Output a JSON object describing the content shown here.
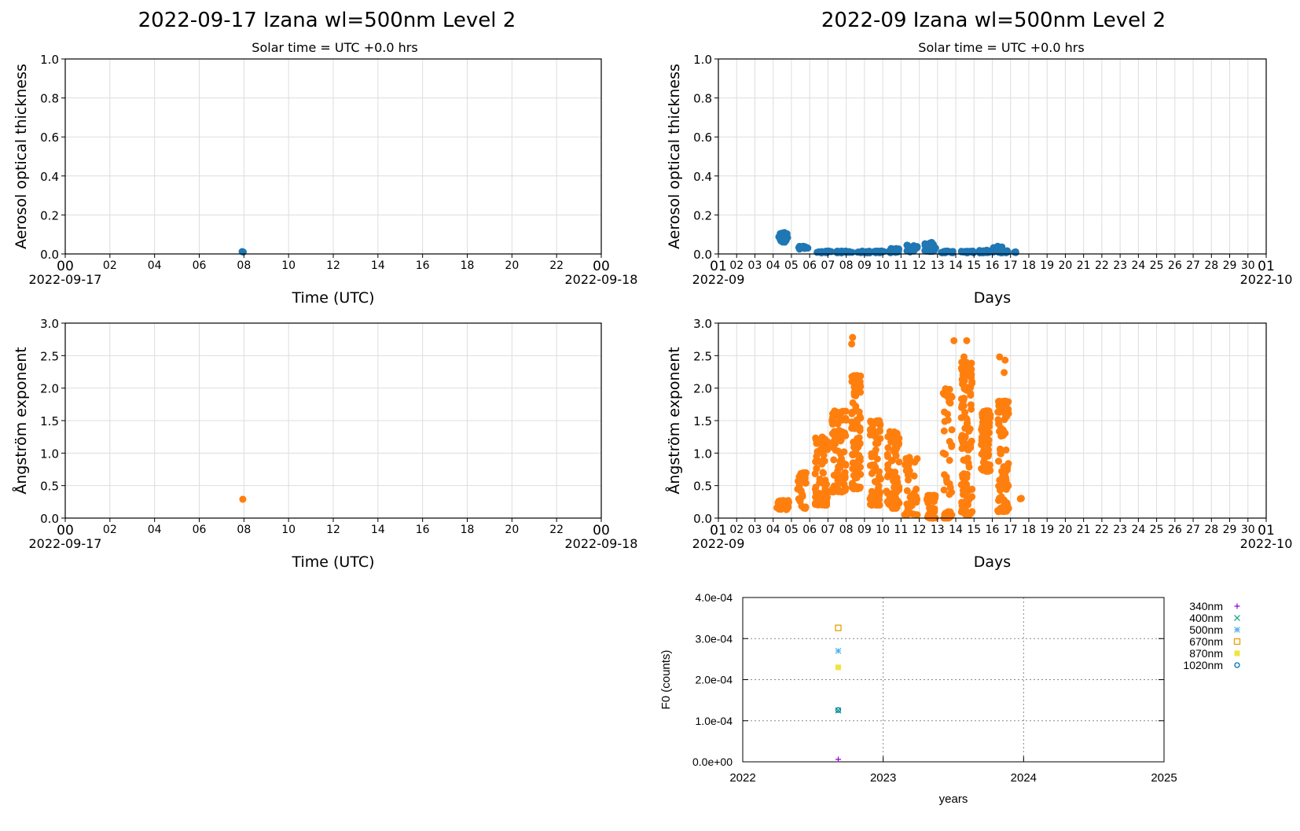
{
  "titles": {
    "left": "2022-09-17  Izana  wl=500nm  Level 2",
    "right": "2022-09  Izana  wl=500nm  Level 2"
  },
  "subtitles": {
    "left": "Solar time = UTC +0.0 hrs",
    "right": "Solar time = UTC +0.0 hrs"
  },
  "colors": {
    "aod": "#1f77b4",
    "angstrom": "#ff7f0e",
    "grid": "#dddddd"
  },
  "chart_data": [
    {
      "id": "daily-aod",
      "type": "scatter",
      "ylabel": "Aerosol optical thickness",
      "xlabel": "Time (UTC)",
      "ylim": [
        0.0,
        1.0
      ],
      "yticks": [
        "0.0",
        "0.2",
        "0.4",
        "0.6",
        "0.8",
        "1.0"
      ],
      "xticks": [
        "00",
        "02",
        "04",
        "06",
        "08",
        "10",
        "12",
        "14",
        "16",
        "18",
        "20",
        "22",
        "00"
      ],
      "xstart_label": "2022-09-17",
      "xend_label": "2022-09-18",
      "xlim_hours": [
        0,
        24
      ],
      "grid": true,
      "series": [
        {
          "points": [
            [
              7.92,
              0.012
            ],
            [
              7.97,
              0.01
            ]
          ]
        }
      ]
    },
    {
      "id": "daily-angstrom",
      "type": "scatter",
      "ylabel": "Ångström exponent",
      "xlabel": "Time (UTC)",
      "ylim": [
        0.0,
        3.0
      ],
      "yticks": [
        "0.0",
        "0.5",
        "1.0",
        "1.5",
        "2.0",
        "2.5",
        "3.0"
      ],
      "xticks": [
        "00",
        "02",
        "04",
        "06",
        "08",
        "10",
        "12",
        "14",
        "16",
        "18",
        "20",
        "22",
        "00"
      ],
      "xstart_label": "2022-09-17",
      "xend_label": "2022-09-18",
      "xlim_hours": [
        0,
        24
      ],
      "grid": true,
      "series": [
        {
          "points": [
            [
              7.95,
              0.29
            ]
          ]
        }
      ]
    },
    {
      "id": "monthly-aod",
      "type": "scatter",
      "ylabel": "Aerosol optical thickness",
      "xlabel": "Days",
      "ylim": [
        0.0,
        1.0
      ],
      "yticks": [
        "0.0",
        "0.2",
        "0.4",
        "0.6",
        "0.8",
        "1.0"
      ],
      "xticks": [
        "01",
        "02",
        "03",
        "04",
        "05",
        "06",
        "07",
        "08",
        "09",
        "10",
        "11",
        "12",
        "13",
        "14",
        "15",
        "16",
        "17",
        "18",
        "19",
        "20",
        "21",
        "22",
        "23",
        "24",
        "25",
        "26",
        "27",
        "28",
        "29",
        "30",
        "01"
      ],
      "xstart_label": "2022-09",
      "xend_label": "2022-10",
      "xlim_days": [
        1,
        31
      ],
      "grid": true,
      "clusters": [
        {
          "x0": 4.3,
          "x1": 4.8,
          "y0": 0.06,
          "y1": 0.11,
          "n": 40
        },
        {
          "x0": 5.4,
          "x1": 5.9,
          "y0": 0.02,
          "y1": 0.04,
          "n": 16
        },
        {
          "x0": 6.4,
          "x1": 7.2,
          "y0": 0.005,
          "y1": 0.015,
          "n": 18
        },
        {
          "x0": 7.4,
          "x1": 8.4,
          "y0": 0.005,
          "y1": 0.015,
          "n": 20
        },
        {
          "x0": 8.6,
          "x1": 9.3,
          "y0": 0.005,
          "y1": 0.015,
          "n": 16
        },
        {
          "x0": 9.5,
          "x1": 10.1,
          "y0": 0.005,
          "y1": 0.015,
          "n": 14
        },
        {
          "x0": 10.3,
          "x1": 11.0,
          "y0": 0.005,
          "y1": 0.03,
          "n": 18
        },
        {
          "x0": 11.3,
          "x1": 11.9,
          "y0": 0.01,
          "y1": 0.045,
          "n": 22
        },
        {
          "x0": 12.3,
          "x1": 12.9,
          "y0": 0.01,
          "y1": 0.06,
          "n": 26
        },
        {
          "x0": 13.2,
          "x1": 13.9,
          "y0": 0.005,
          "y1": 0.015,
          "n": 16
        },
        {
          "x0": 14.2,
          "x1": 15.0,
          "y0": 0.005,
          "y1": 0.015,
          "n": 18
        },
        {
          "x0": 15.2,
          "x1": 15.9,
          "y0": 0.005,
          "y1": 0.02,
          "n": 18
        },
        {
          "x0": 16.0,
          "x1": 16.9,
          "y0": 0.005,
          "y1": 0.04,
          "n": 22
        },
        {
          "x0": 17.2,
          "x1": 17.3,
          "y0": 0.005,
          "y1": 0.012,
          "n": 3
        }
      ]
    },
    {
      "id": "monthly-angstrom",
      "type": "scatter",
      "ylabel": "Ångström exponent",
      "xlabel": "Days",
      "ylim": [
        0.0,
        3.0
      ],
      "yticks": [
        "0.0",
        "0.5",
        "1.0",
        "1.5",
        "2.0",
        "2.5",
        "3.0"
      ],
      "xticks": [
        "01",
        "02",
        "03",
        "04",
        "05",
        "06",
        "07",
        "08",
        "09",
        "10",
        "11",
        "12",
        "13",
        "14",
        "15",
        "16",
        "17",
        "18",
        "19",
        "20",
        "21",
        "22",
        "23",
        "24",
        "25",
        "26",
        "27",
        "28",
        "29",
        "30",
        "01"
      ],
      "xstart_label": "2022-09",
      "xend_label": "2022-10",
      "xlim_days": [
        1,
        31
      ],
      "grid": true,
      "clusters": [
        {
          "x0": 4.2,
          "x1": 4.9,
          "y0": 0.13,
          "y1": 0.27,
          "n": 26
        },
        {
          "x0": 5.3,
          "x1": 5.8,
          "y0": 0.15,
          "y1": 0.7,
          "n": 30
        },
        {
          "x0": 6.3,
          "x1": 7.0,
          "y0": 0.2,
          "y1": 1.25,
          "n": 70
        },
        {
          "x0": 7.2,
          "x1": 8.0,
          "y0": 0.4,
          "y1": 1.65,
          "n": 90
        },
        {
          "x0": 8.3,
          "x1": 8.8,
          "y0": 0.45,
          "y1": 2.2,
          "n": 100
        },
        {
          "x0": 9.3,
          "x1": 9.9,
          "y0": 0.2,
          "y1": 1.5,
          "n": 70
        },
        {
          "x0": 10.2,
          "x1": 10.9,
          "y0": 0.15,
          "y1": 1.33,
          "n": 80
        },
        {
          "x0": 11.2,
          "x1": 11.9,
          "y0": 0.05,
          "y1": 0.95,
          "n": 50
        },
        {
          "x0": 12.4,
          "x1": 12.9,
          "y0": 0.0,
          "y1": 0.35,
          "n": 40
        },
        {
          "x0": 13.3,
          "x1": 13.8,
          "y0": 0.0,
          "y1": 2.0,
          "n": 45
        },
        {
          "x0": 14.3,
          "x1": 14.9,
          "y0": 0.05,
          "y1": 2.4,
          "n": 110
        },
        {
          "x0": 15.4,
          "x1": 15.9,
          "y0": 0.72,
          "y1": 1.65,
          "n": 80
        },
        {
          "x0": 16.3,
          "x1": 16.9,
          "y0": 0.1,
          "y1": 1.8,
          "n": 90
        },
        {
          "x0": 17.4,
          "x1": 17.6,
          "y0": 0.27,
          "y1": 0.31,
          "n": 3
        }
      ],
      "outliers": [
        [
          8.35,
          2.78
        ],
        [
          8.3,
          2.68
        ],
        [
          13.9,
          2.73
        ],
        [
          14.6,
          2.73
        ],
        [
          14.45,
          2.48
        ],
        [
          16.4,
          2.48
        ],
        [
          16.7,
          2.43
        ],
        [
          16.65,
          2.24
        ],
        [
          13.7,
          1.77
        ]
      ]
    },
    {
      "id": "f0-calibration",
      "type": "scatter",
      "ylabel": "F0 (counts)",
      "xlabel": "years",
      "ylim": [
        0.0,
        0.0004
      ],
      "yticks": [
        "0.0e+00",
        "1.0e-04",
        "2.0e-04",
        "3.0e-04",
        "4.0e-04"
      ],
      "xticks": [
        "2022",
        "2023",
        "2024",
        "2025"
      ],
      "xlim": [
        2022,
        2025
      ],
      "grid": true,
      "series": [
        {
          "name": "340nm",
          "marker": "plus",
          "color": "#9400d3",
          "x": 2022.68,
          "y": 6e-06
        },
        {
          "name": "400nm",
          "marker": "cross",
          "color": "#009e73",
          "x": 2022.68,
          "y": 0.000125
        },
        {
          "name": "500nm",
          "marker": "star",
          "color": "#56b4e9",
          "x": 2022.68,
          "y": 0.00027
        },
        {
          "name": "670nm",
          "marker": "square-open",
          "color": "#e69f00",
          "x": 2022.68,
          "y": 0.000326
        },
        {
          "name": "870nm",
          "marker": "square-filled",
          "color": "#f0e442",
          "x": 2022.68,
          "y": 0.00023
        },
        {
          "name": "1020nm",
          "marker": "circle-open",
          "color": "#0072b2",
          "x": 2022.68,
          "y": 0.000126
        }
      ]
    }
  ]
}
